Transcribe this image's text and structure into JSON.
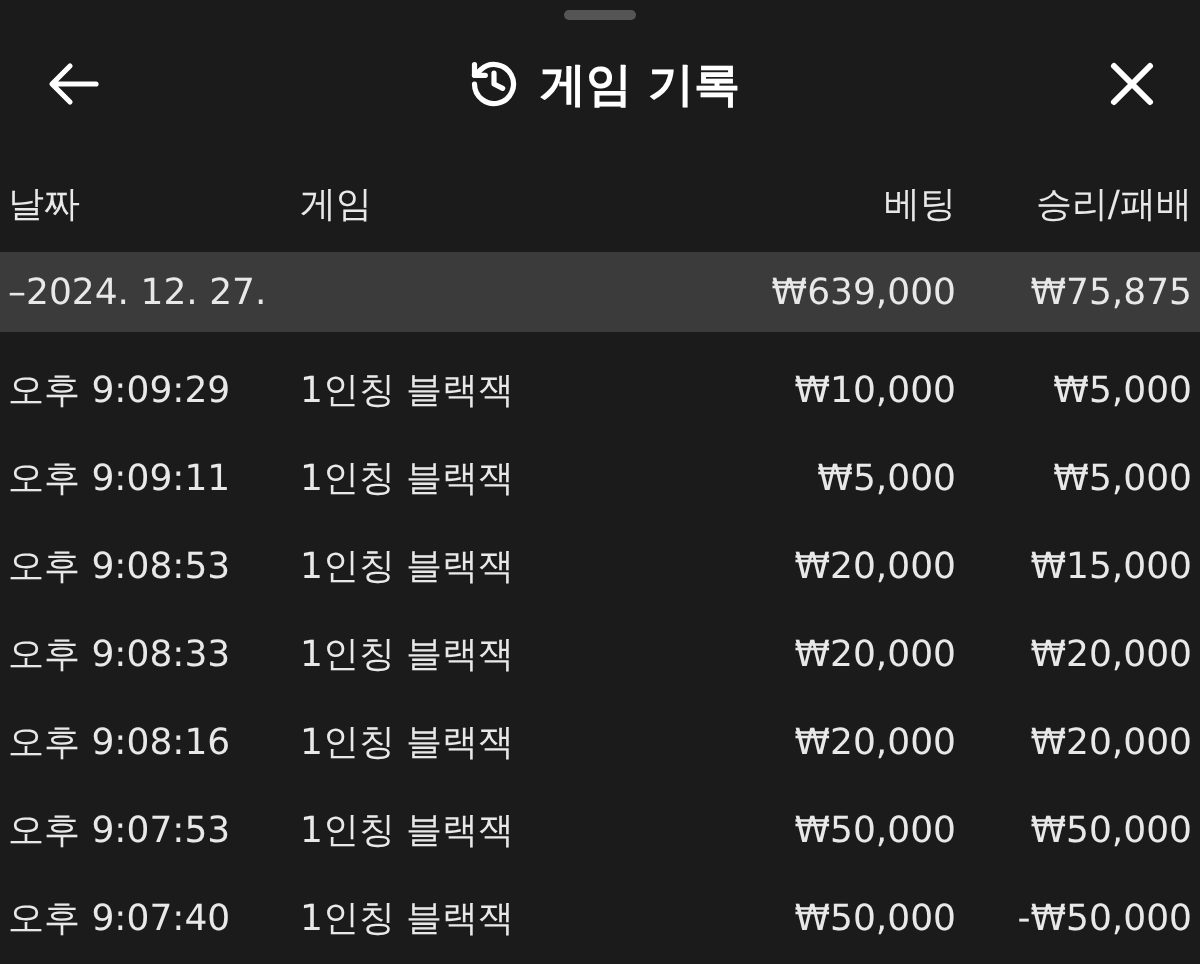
{
  "header": {
    "title": "게임 기록"
  },
  "columns": [
    "날짜",
    "게임",
    "베팅",
    "승리/패배"
  ],
  "group": {
    "date": "–2024. 12. 27.",
    "bet": "₩639,000",
    "result": "₩75,875"
  },
  "rows": [
    {
      "time": "오후 9:09:29",
      "game": "1인칭 블랙잭",
      "bet": "₩10,000",
      "result": "₩5,000"
    },
    {
      "time": "오후 9:09:11",
      "game": "1인칭 블랙잭",
      "bet": "₩5,000",
      "result": "₩5,000"
    },
    {
      "time": "오후 9:08:53",
      "game": "1인칭 블랙잭",
      "bet": "₩20,000",
      "result": "₩15,000"
    },
    {
      "time": "오후 9:08:33",
      "game": "1인칭 블랙잭",
      "bet": "₩20,000",
      "result": "₩20,000"
    },
    {
      "time": "오후 9:08:16",
      "game": "1인칭 블랙잭",
      "bet": "₩20,000",
      "result": "₩20,000"
    },
    {
      "time": "오후 9:07:53",
      "game": "1인칭 블랙잭",
      "bet": "₩50,000",
      "result": "₩50,000"
    },
    {
      "time": "오후 9:07:40",
      "game": "1인칭 블랙잭",
      "bet": "₩50,000",
      "result": "-₩50,000"
    }
  ]
}
